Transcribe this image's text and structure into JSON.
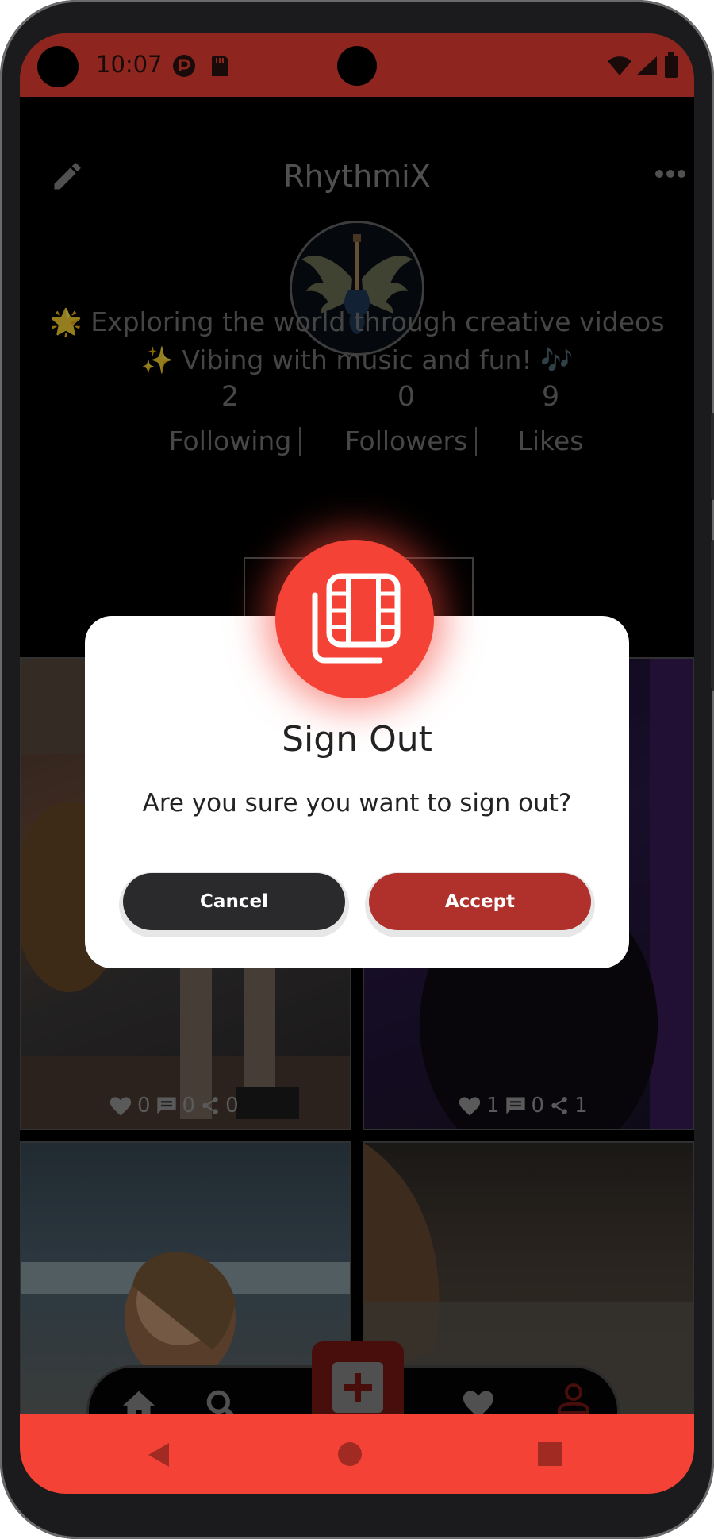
{
  "status_bar": {
    "time": "10:07"
  },
  "profile": {
    "username": "RhythmiX",
    "bio_line1": "🌟 Exploring the world through creative videos",
    "bio_line2": "✨ Vibing with music and fun! 🎶",
    "stats": [
      {
        "value": "2",
        "label": "Following"
      },
      {
        "value": "0",
        "label": "Followers"
      },
      {
        "value": "9",
        "label": "Likes"
      }
    ]
  },
  "videos": [
    {
      "likes": "0",
      "comments": "0",
      "shares": "0"
    },
    {
      "likes": "1",
      "comments": "0",
      "shares": "1"
    }
  ],
  "dialog": {
    "title": "Sign Out",
    "message": "Are you sure you want to sign out?",
    "cancel_label": "Cancel",
    "accept_label": "Accept"
  },
  "colors": {
    "accent": "#f44336",
    "accept": "#b0302b",
    "cancel": "#2a2a2c"
  }
}
